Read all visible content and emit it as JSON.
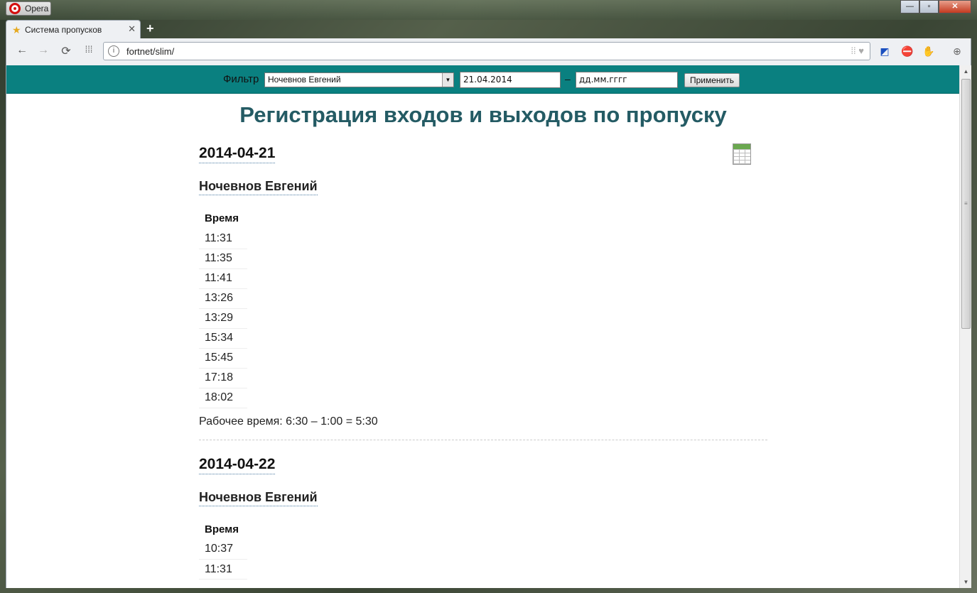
{
  "browser": {
    "menu_label": "Opera",
    "tab_title": "Система пропусков",
    "tab_close": "✕",
    "new_tab": "+",
    "url": "fortnet/slim/",
    "win_minimize": "—",
    "win_maximize": "▫",
    "win_close": "✕"
  },
  "filter": {
    "label": "Фильтр",
    "selected_person": "Ночевнов Евгений",
    "date_from": "21.04.2014",
    "date_to_placeholder": "дд.мм.гггг",
    "dash": "–",
    "apply_label": "Применить"
  },
  "page": {
    "title": "Регистрация входов и выходов по пропуску"
  },
  "days": [
    {
      "date": "2014-04-21",
      "person": "Ночевнов Евгений",
      "time_header": "Время",
      "times": [
        "11:31",
        "11:35",
        "11:41",
        "13:26",
        "13:29",
        "15:34",
        "15:45",
        "17:18",
        "18:02"
      ],
      "worktime": "Рабочее время: 6:30 – 1:00 = 5:30"
    },
    {
      "date": "2014-04-22",
      "person": "Ночевнов Евгений",
      "time_header": "Время",
      "times": [
        "10:37",
        "11:31"
      ]
    }
  ]
}
